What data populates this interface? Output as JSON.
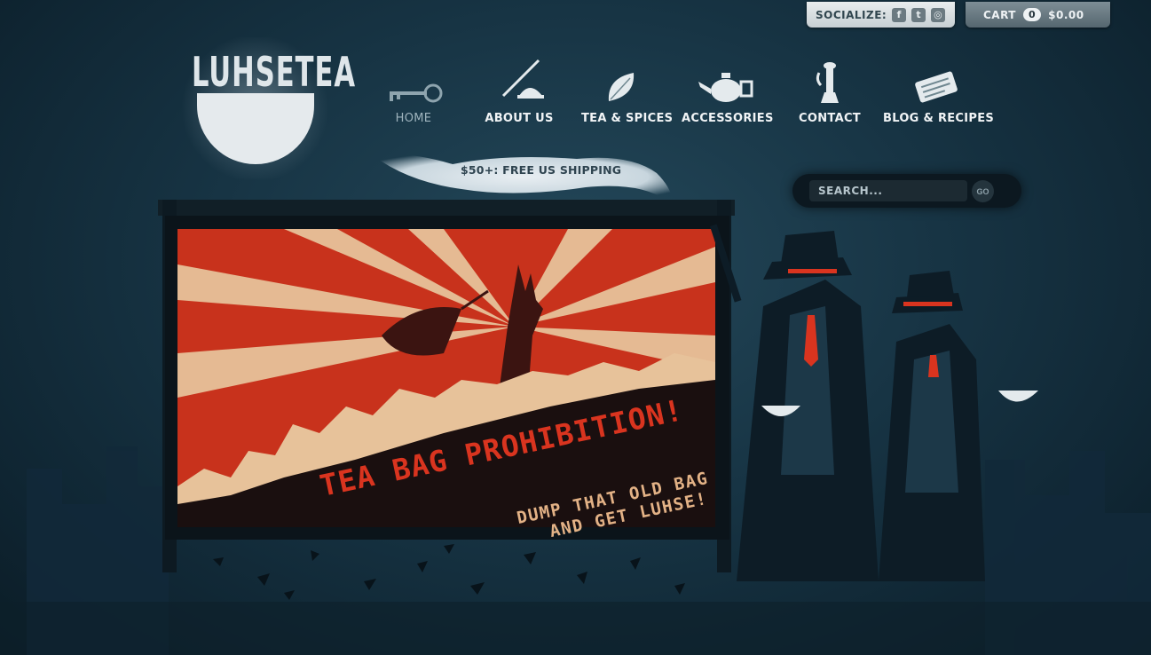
{
  "social": {
    "label": "SOCIALIZE:",
    "icons": [
      "facebook-icon",
      "twitter-icon",
      "instagram-icon"
    ],
    "facebook_glyph": "f",
    "twitter_glyph": "t",
    "instagram_glyph": "◎"
  },
  "cart": {
    "label": "CART",
    "count": "0",
    "total": "$0.00"
  },
  "logo": {
    "text": "LUHSETEA"
  },
  "nav": [
    {
      "label": "HOME",
      "icon": "key-icon",
      "active": true
    },
    {
      "label": "ABOUT US",
      "icon": "quill-bell-icon"
    },
    {
      "label": "TEA & SPICES",
      "icon": "leaf-icon"
    },
    {
      "label": "ACCESSORIES",
      "icon": "teapot-icon"
    },
    {
      "label": "CONTACT",
      "icon": "telephone-icon"
    },
    {
      "label": "BLOG & RECIPES",
      "icon": "newspaper-icon"
    }
  ],
  "shipping": {
    "text": "$50+: FREE US SHIPPING"
  },
  "search": {
    "placeholder": "SEARCH...",
    "button": "GO"
  },
  "billboard": {
    "headline": "TEA BAG PROHIBITION!",
    "sub_line1": "DUMP THAT OLD BAG",
    "sub_line2": "AND GET LUHSE!"
  },
  "colors": {
    "background": "#173444",
    "poster_red": "#c8321c",
    "poster_cream": "#e7c29a",
    "accent_red": "#d9341f"
  }
}
